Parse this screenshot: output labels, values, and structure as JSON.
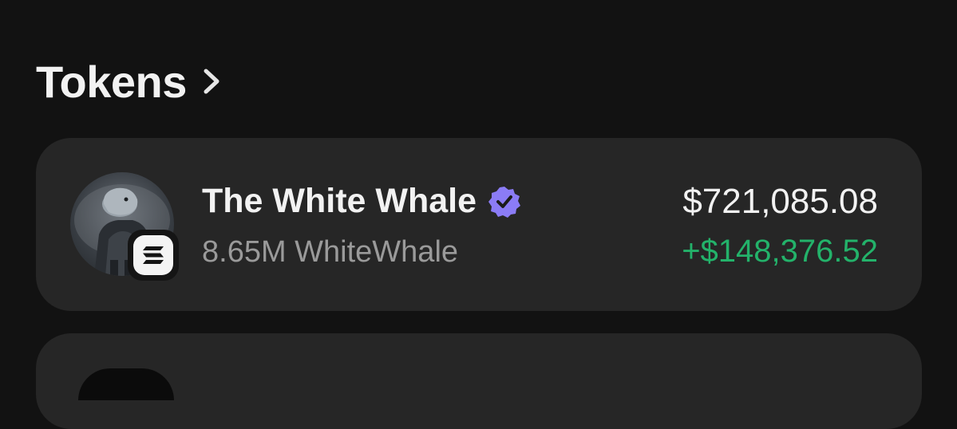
{
  "section": {
    "title": "Tokens",
    "chevron_icon": "chevron-right-icon"
  },
  "tokens": [
    {
      "name": "The White Whale",
      "verified_icon": "verified-badge-icon",
      "amount": "8.65M WhiteWhale",
      "value": "$721,085.08",
      "change": "+$148,376.52",
      "chain_icon": "solana-icon",
      "avatar_icon": "whale-avatar"
    }
  ],
  "colors": {
    "background": "#121212",
    "card": "#262626",
    "positive": "#23b26a",
    "verified": "#8b7cf6"
  }
}
